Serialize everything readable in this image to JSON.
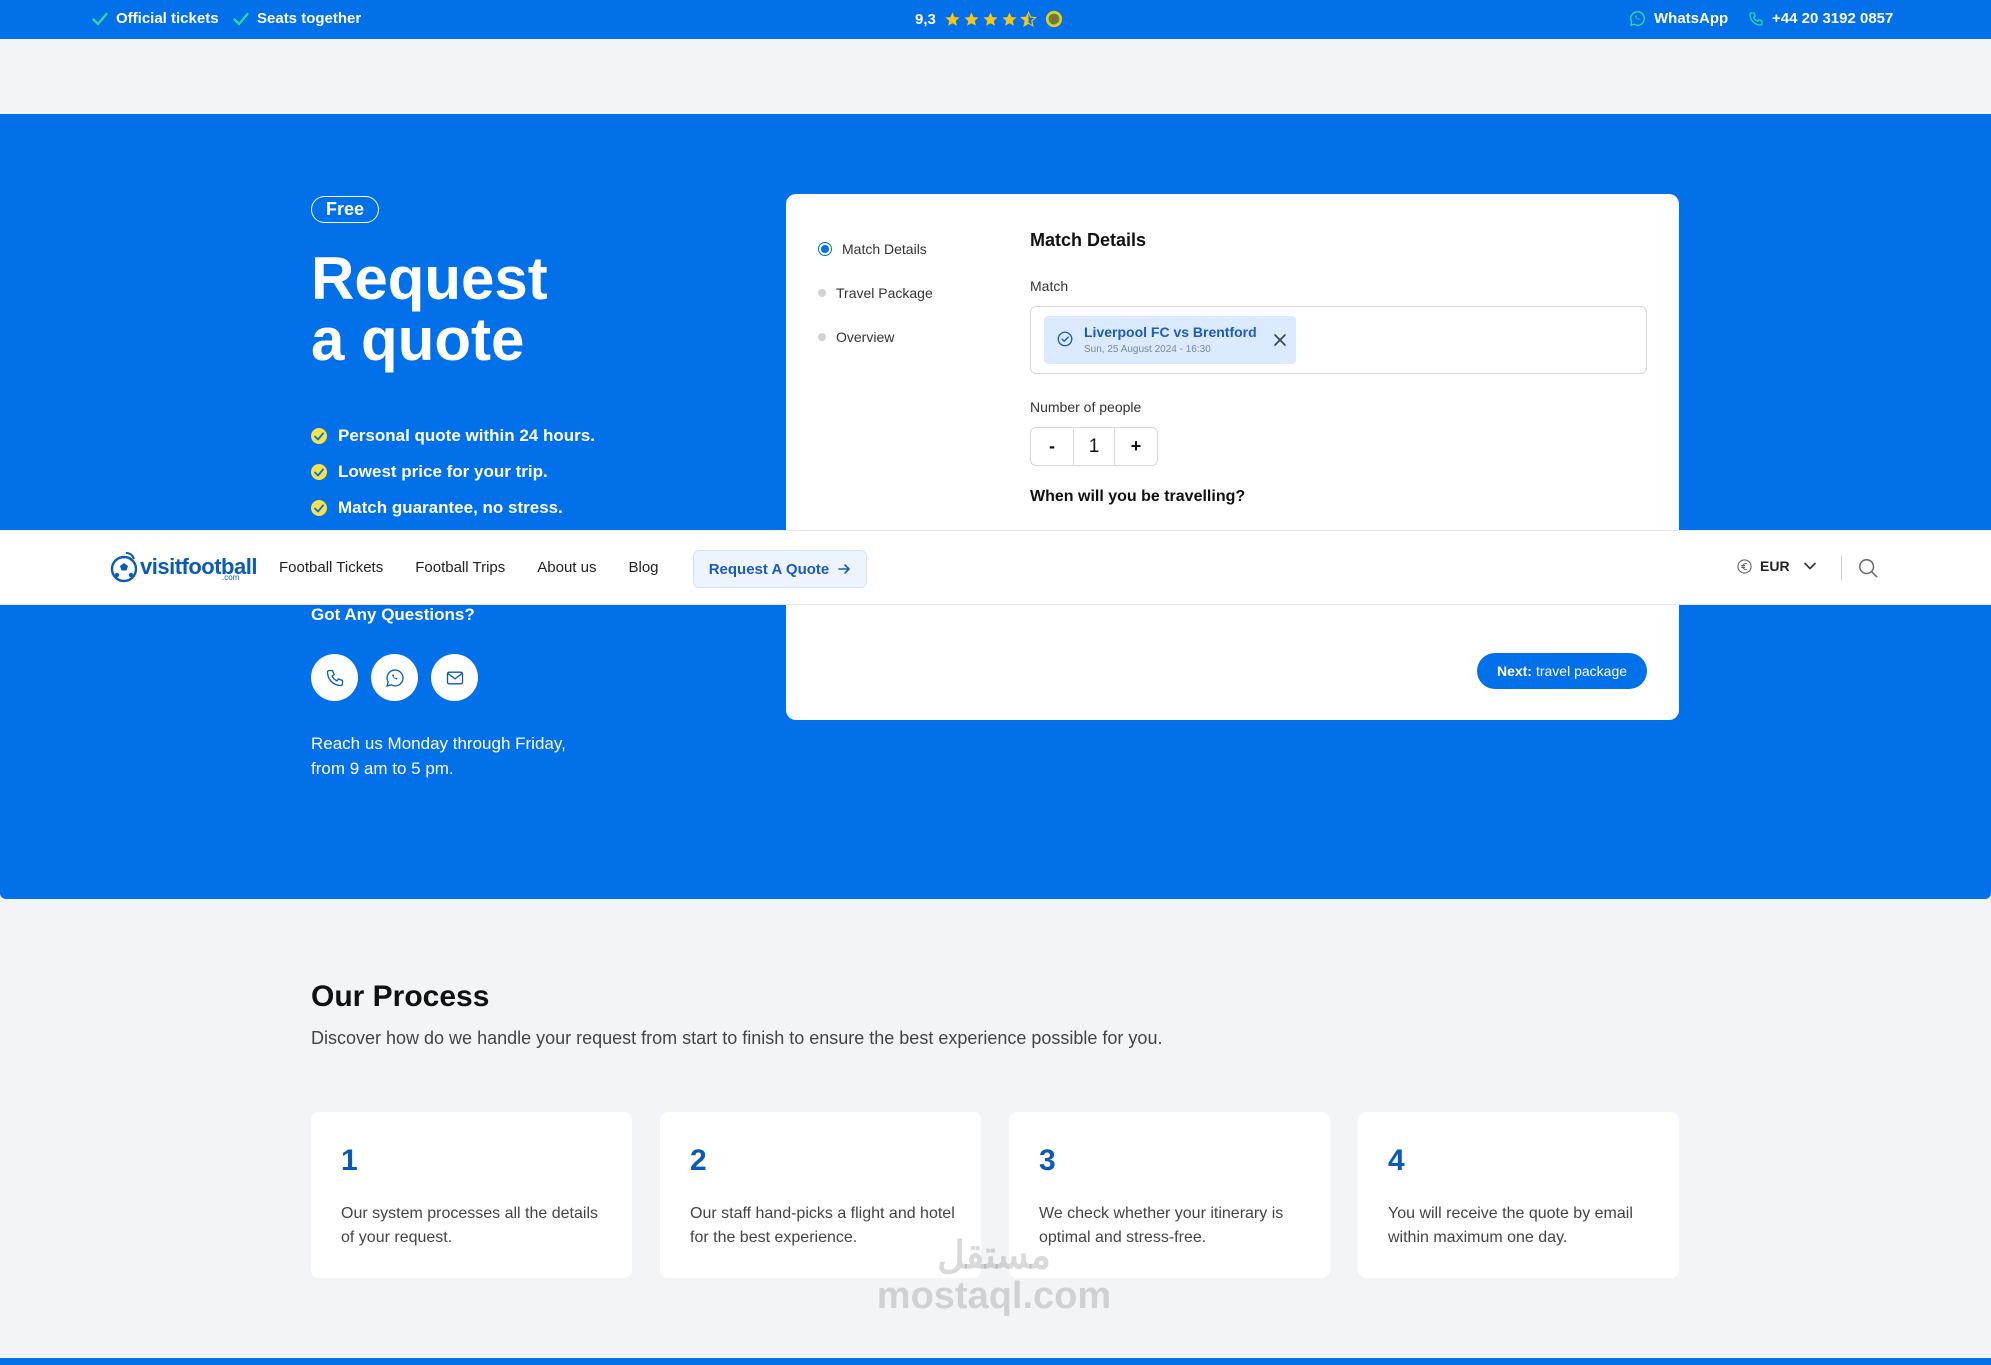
{
  "topbar": {
    "official": "Official tickets",
    "seats": "Seats together",
    "rating": "9,3",
    "rating_stars": 4.5,
    "whatsapp": "WhatsApp",
    "phone": "+44 20 3192 0857"
  },
  "hero": {
    "badge": "Free",
    "title_line1": "Request",
    "title_line2": "a quote",
    "bullets": [
      "Personal quote within 24 hours.",
      "Lowest price for your trip.",
      "Match guarantee, no stress."
    ],
    "questions": "Got Any Questions?",
    "reach_line1": "Reach us Monday through Friday,",
    "reach_line2": "from 9 am to 5 pm."
  },
  "form": {
    "steps": [
      "Match Details",
      "Travel Package",
      "Overview"
    ],
    "title": "Match Details",
    "match_label": "Match",
    "match_name": "Liverpool FC vs Brentford",
    "match_date": "Sun, 25 August 2024 - 16:30",
    "people_label": "Number of people",
    "people_minus": "-",
    "people_value": "1",
    "people_plus": "+",
    "travel_question": "When will you be travelling?",
    "next_bold": "Next:",
    "next_label": "travel package"
  },
  "nav": {
    "logo": "visitfootball",
    "logo_sub": ".com",
    "links": [
      "Football Tickets",
      "Football Trips",
      "About us",
      "Blog"
    ],
    "quote_button": "Request A Quote",
    "currency": "EUR"
  },
  "process": {
    "title": "Our Process",
    "subtitle": "Discover how do we handle your request from start to finish to ensure the best experience possible for you.",
    "cards": [
      {
        "num": "1",
        "text": "Our system processes all the details of your request."
      },
      {
        "num": "2",
        "text": "Our staff hand-picks a flight and hotel for the best experience."
      },
      {
        "num": "3",
        "text": "We check whether your itinerary is optimal and stress-free."
      },
      {
        "num": "4",
        "text": "You will receive the quote by email within maximum one day."
      }
    ]
  },
  "watermark": {
    "line1": "مستقل",
    "line2": "mostaql.com"
  },
  "colors": {
    "brand": "#0170e9",
    "accent_yellow": "#f8e14b",
    "star": "#f5c518"
  }
}
